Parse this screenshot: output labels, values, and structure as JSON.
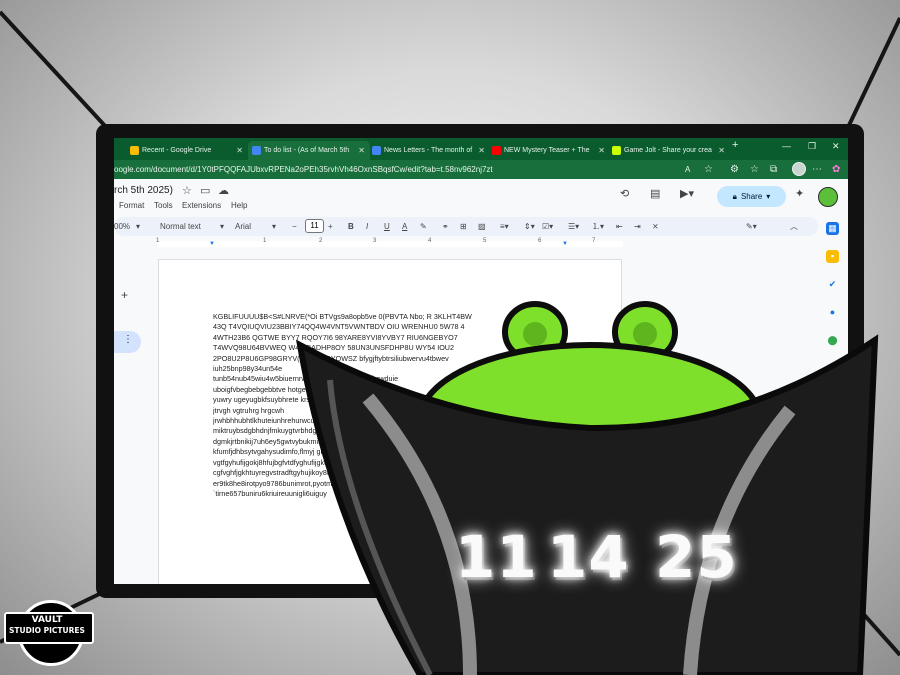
{
  "browser": {
    "tabs": [
      {
        "label": "Recent - Google Drive",
        "icon": "google-drive-icon",
        "color": "#fbbc04"
      },
      {
        "label": "To do list - (As of March 5th",
        "icon": "google-docs-icon",
        "color": "#4285f4"
      },
      {
        "label": "News Letters - The month of",
        "icon": "google-docs-icon",
        "color": "#4285f4"
      },
      {
        "label": "NEW Mystery Teaser + The",
        "icon": "youtube-icon",
        "color": "#ff0000"
      },
      {
        "label": "Game Jolt - Share your crea",
        "icon": "game-jolt-icon",
        "color": "#ccff00"
      }
    ],
    "new_tab": "+",
    "url": "oogle.com/document/d/1Y0tPFQQFAJUbxvRPENa2oPEh35rvhVh46OxnSBqsfCw/edit?tab=t.58nv962nj7zt"
  },
  "docs": {
    "title": "rch 5th 2025)",
    "menu": [
      "Format",
      "Tools",
      "Extensions",
      "Help"
    ],
    "share_label": "Share",
    "toolbar": {
      "zoom": "00%",
      "style": "Normal text",
      "font": "Arial",
      "font_size": "11"
    },
    "ruler_numbers": [
      "1",
      "1",
      "2",
      "3",
      "4",
      "5",
      "6",
      "7"
    ],
    "body_lines": [
      "KGBLIFUUUU$B<S#LNRVE(*Oi BTVgs9a8opb5ve 0(PBVTA Nbo; R  3KLHT4BW",
      "43Q T4VQIUQVIU23BBIY74QQ4W4VNT5VWNTBDV OIU WRENHU0 5W78 4",
      "4WTH23B6 QGTWE BYY7 RQOY7I6 98YARE8YVI8YVBY7 RIU6NGEBYO7",
      "T4WVQ98U64BVWEQ  W4Y RADHP8OY 58UN3UNSFDHP8U WY54 IOU2",
      "2PO8U2P8U6GP98GRYV(g AWEABYQWSZ bfygjftybtrsiliubwervu4tbwev",
      "iuh25bnp98y34un54e",
      "tunb54nub45wiu4w5biuernrweiu eurtyffgdffvlhcdnjkcwduie",
      "uboigfvbegbebgebbtve hotgen8t ewreinhtrcyuq",
      "yuwry ugeyugbkfsuybhrete krseur",
      "jtrvgh vgtruhrg hrgcwh",
      "jrwhbhhubhtlkhuteiunhrehurwcuncw",
      "miktruybsdgbhdnjfmkuygtvrbhdgjfkmsi",
      "dgmkjrtbnikij7uh6ey5gwtvybukmiftsdh",
      "kfumfjdhbsytvgahysudimfo,flmyj ghbyrt",
      "vgtfgyhufijgokj8hfujbgfvtdfyghufijgkohjlhu",
      "cgfvghfjgkhtuyregvstradftgyhujikoy8uhbdt",
      "er9tk8he8irotpyo9786bunimrot,pyotmimue",
      "`tirne657buniru6kriuireuunigli6uiguy"
    ]
  },
  "overlay": {
    "date_parts": [
      "11",
      "14",
      "25"
    ],
    "logo_line1": "VAULT",
    "logo_line2": "STUDIO PICTURES",
    "accent_green": "#7ee02b",
    "dark_shell": "#1c1c1c"
  }
}
